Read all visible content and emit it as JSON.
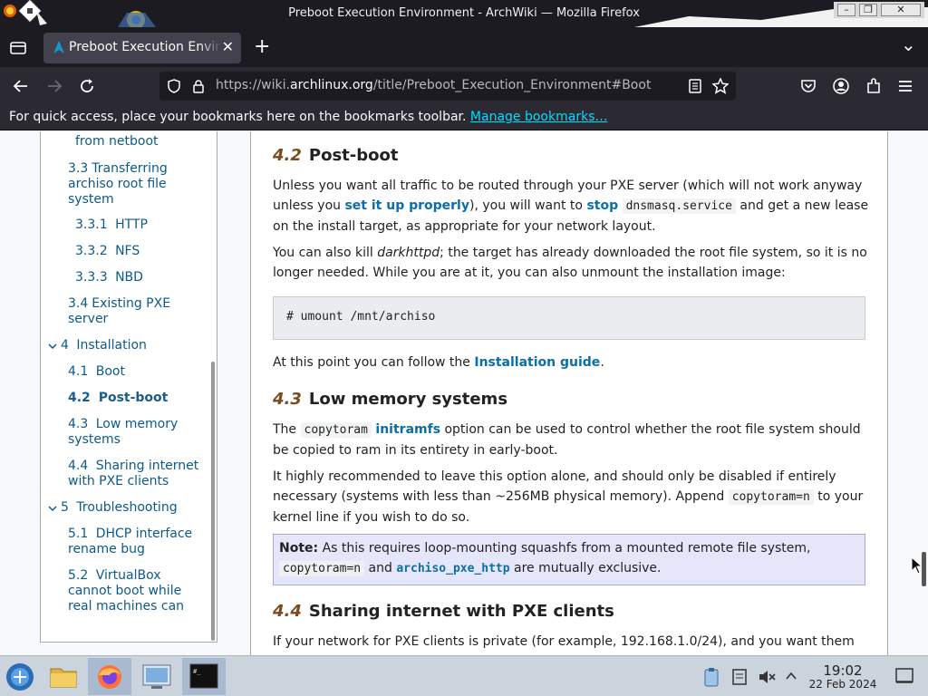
{
  "window": {
    "title": "Preboot Execution Environment - ArchWiki — Mozilla Firefox",
    "buttons": [
      "–",
      "❐",
      "✕"
    ]
  },
  "tabbar": {
    "tab_label": "Preboot Execution Environment - ArchWiki",
    "tab_close": "✕",
    "new_tab": "+",
    "list_all_tabs": "⌄"
  },
  "navbar": {
    "url_scheme": "https://wiki.",
    "url_domain": "archlinux.org",
    "url_path": "/title/Preboot_Execution_Environment#Boot"
  },
  "bookmarks": {
    "message": "For quick access, place your bookmarks here on the bookmarks toolbar.",
    "manage_link": "Manage bookmarks…"
  },
  "toc": {
    "items": [
      {
        "num": "",
        "label": "from netboot"
      },
      {
        "num": "3.3",
        "label": "Transferring archiso root file system"
      },
      {
        "num": "3.3.1",
        "label": "HTTP"
      },
      {
        "num": "3.3.2",
        "label": "NFS"
      },
      {
        "num": "3.3.3",
        "label": "NBD"
      },
      {
        "num": "3.4",
        "label": "Existing PXE server"
      },
      {
        "num": "4",
        "label": "Installation"
      },
      {
        "num": "4.1",
        "label": "Boot"
      },
      {
        "num": "4.2",
        "label": "Post-boot"
      },
      {
        "num": "4.3",
        "label": "Low memory systems"
      },
      {
        "num": "4.4",
        "label": "Sharing internet with PXE clients"
      },
      {
        "num": "5",
        "label": "Troubleshooting"
      },
      {
        "num": "5.1",
        "label": "DHCP interface rename bug"
      },
      {
        "num": "5.2",
        "label": "VirtualBox cannot boot while real machines can"
      }
    ]
  },
  "content": {
    "h_42_num": "4.2",
    "h_42": "Post-boot",
    "p1_a": "Unless you want all traffic to be routed through your PXE server (which will not work anyway unless you ",
    "p1_link1": "set it up properly",
    "p1_b": "), you will want to ",
    "p1_link2": "stop",
    "p1_code": "dnsmasq.service",
    "p1_c": " and get a new lease on the install target, as appropriate for your network layout.",
    "p2_a": "You can also kill ",
    "p2_em": "darkhttpd",
    "p2_b": "; the target has already downloaded the root file system, so it is no longer needed. While you are at it, you can also unmount the installation image:",
    "pre1": "# umount /mnt/archiso",
    "p3_a": "At this point you can follow the ",
    "p3_link": "Installation guide",
    "p3_b": ".",
    "h_43_num": "4.3",
    "h_43": "Low memory systems",
    "p4_a": "The ",
    "p4_code": "copytoram",
    "p4_link": "initramfs",
    "p4_b": " option can be used to control whether the root file system should be copied to ram in its entirety in early-boot.",
    "p5_a": "It highly recommended to leave this option alone, and should only be disabled if entirely necessary (systems with less than ~256MB physical memory). Append ",
    "p5_code": "copytoram=n",
    "p5_b": " to your kernel line if you wish to do so.",
    "note_label": "Note:",
    "note_a": " As this requires loop-mounting squashfs from a mounted remote file system, ",
    "note_code": "copytoram=n",
    "note_b": " and ",
    "note_link": "archiso_pxe_http",
    "note_c": " are mutually exclusive.",
    "h_44_num": "4.4",
    "h_44": "Sharing internet with PXE clients",
    "p6": "If your network for PXE clients is private (for example, 192.168.1.0/24), and you want them"
  },
  "taskbar": {
    "time": "19:02",
    "date": "22 Feb 2024"
  }
}
